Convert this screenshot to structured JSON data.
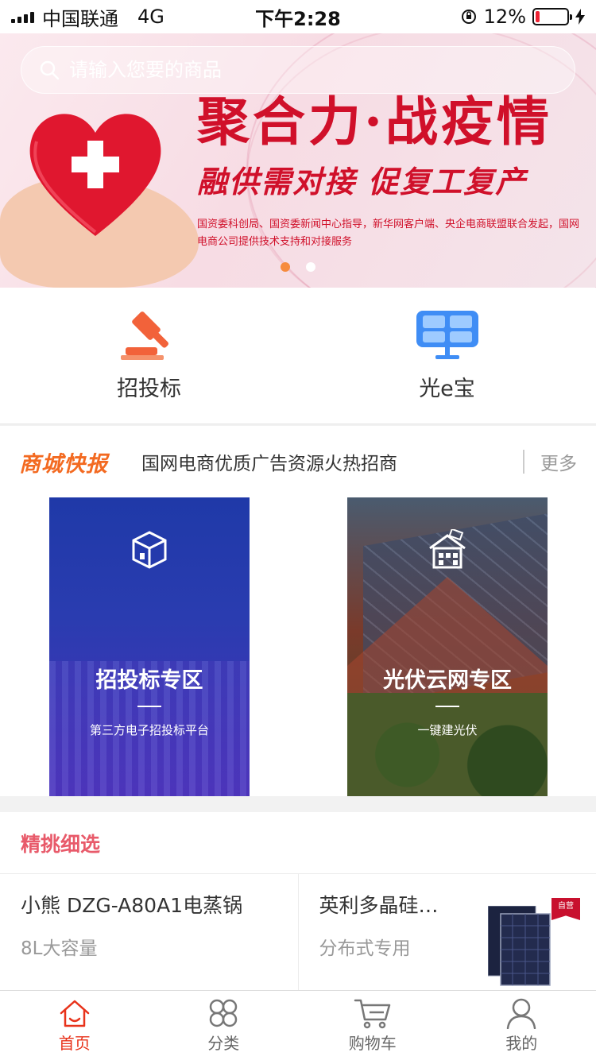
{
  "status_bar": {
    "carrier": "中国联通",
    "network": "4G",
    "time": "下午2:28",
    "battery": "12%",
    "battery_level": 0.12
  },
  "banner": {
    "search_placeholder": "请输入您要的商品",
    "title": "聚合力·战疫情",
    "subtitle": "融供需对接 促复工复产",
    "description": "国资委科创局、国资委新闻中心指导，新华网客户端、央企电商联盟联合发起，国网电商公司提供技术支持和对接服务",
    "active_slide": 1,
    "slide_count": 2
  },
  "quick_entries": [
    {
      "label": "招投标",
      "icon": "gavel-icon"
    },
    {
      "label": "光e宝",
      "icon": "solar-panel-icon"
    }
  ],
  "news": {
    "tag": "商城快报",
    "headline": "国网电商优质广告资源火热招商",
    "more": "更多"
  },
  "zone_cards": [
    {
      "title": "招投标专区",
      "subtitle": "第三方电子招投标平台",
      "icon": "cube-icon"
    },
    {
      "title": "光伏云网专区",
      "subtitle": "一键建光伏",
      "icon": "solar-house-icon"
    }
  ],
  "featured": {
    "title": "精挑细选",
    "products": [
      {
        "name": "小熊 DZG-A80A1电蒸锅",
        "desc": "8L大容量"
      },
      {
        "name": "英利多晶硅…",
        "desc": "分布式专用",
        "badge": "自营"
      }
    ]
  },
  "tabbar": [
    {
      "label": "首页",
      "icon": "home-icon",
      "active": true
    },
    {
      "label": "分类",
      "icon": "category-icon",
      "active": false
    },
    {
      "label": "购物车",
      "icon": "cart-icon",
      "active": false
    },
    {
      "label": "我的",
      "icon": "user-icon",
      "active": false
    }
  ],
  "colors": {
    "accent": "#e8321a",
    "news_tag": "#f36a21",
    "featured_title": "#e85a6a",
    "banner_red": "#d0102a"
  }
}
